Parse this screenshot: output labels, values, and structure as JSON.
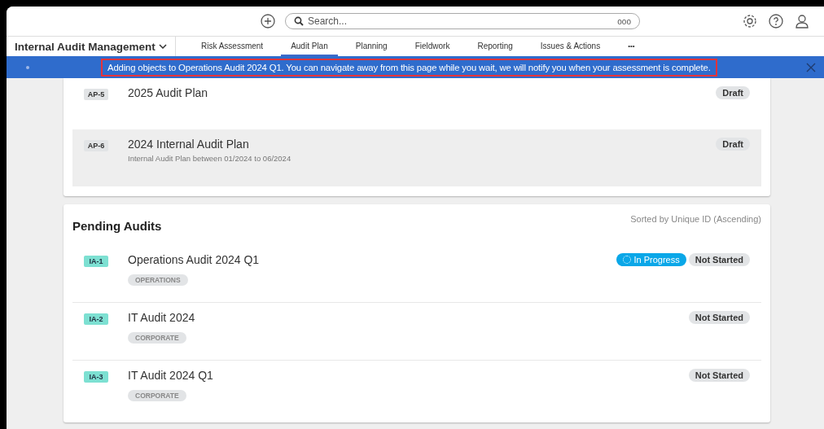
{
  "top_bar": {
    "search": {
      "placeholder": "Search..."
    },
    "search_extra": "ooo"
  },
  "nav": {
    "app_title": "Internal Audit Management",
    "tabs": [
      {
        "label": "Risk Assessment",
        "selected": false
      },
      {
        "label": "Audit Plan",
        "selected": true
      },
      {
        "label": "Planning",
        "selected": false
      },
      {
        "label": "Fieldwork",
        "selected": false
      },
      {
        "label": "Reporting",
        "selected": false
      },
      {
        "label": "Issues & Actions",
        "selected": false
      }
    ],
    "more": "•••"
  },
  "banner": {
    "message": "Adding objects to Operations Audit 2024 Q1. You can navigate away from this page while you wait, we will notify you when your assessment is complete.",
    "highlighted": true
  },
  "plans": [
    {
      "id": "AP-5",
      "title": "2025 Audit Plan",
      "highlighted": false,
      "statuses": [
        {
          "label": "Draft",
          "kind": "neutral"
        }
      ]
    },
    {
      "id": "AP-6",
      "title": "2024 Internal Audit Plan",
      "subtitle": "Internal Audit Plan between 01/2024 to 06/2024",
      "highlighted": true,
      "statuses": [
        {
          "label": "Draft",
          "kind": "neutral"
        }
      ]
    }
  ],
  "pending": {
    "title": "Pending Audits",
    "sort_note": "Sorted by Unique ID (Ascending)",
    "rows": [
      {
        "id": "IA-1",
        "title": "Operations Audit 2024 Q1",
        "tag": "OPERATIONS",
        "statuses": [
          {
            "label": "In Progress",
            "kind": "progress"
          },
          {
            "label": "Not Started",
            "kind": "neutral"
          }
        ]
      },
      {
        "id": "IA-2",
        "title": "IT Audit 2024",
        "tag": "CORPORATE",
        "statuses": [
          {
            "label": "Not Started",
            "kind": "neutral"
          }
        ]
      },
      {
        "id": "IA-3",
        "title": "IT Audit 2024 Q1",
        "tag": "CORPORATE",
        "statuses": [
          {
            "label": "Not Started",
            "kind": "neutral"
          }
        ]
      }
    ]
  }
}
